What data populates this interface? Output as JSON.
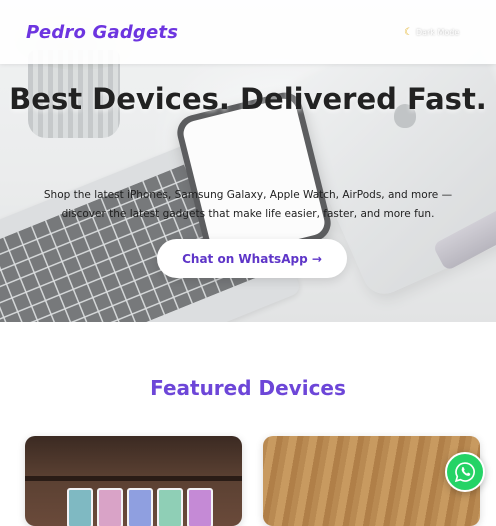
{
  "navbar": {
    "brand": "Pedro Gadgets",
    "dark_mode_icon": "moon-icon",
    "dark_mode_label": "Dark Mode"
  },
  "hero": {
    "title": "Best Devices. Delivered Fast.",
    "subtitle": "Shop the latest iPhones, Samsung Galaxy, Apple Watch, AirPods, and more — discover the latest gadgets that make life easier, faster, and more fun.",
    "cta_label": "Chat on WhatsApp →"
  },
  "featured": {
    "title": "Featured Devices"
  },
  "floating_button": {
    "icon": "whatsapp-icon"
  },
  "colors": {
    "brand": "#6d35e0",
    "accent": "#6d46d8",
    "whatsapp": "#25d366"
  }
}
